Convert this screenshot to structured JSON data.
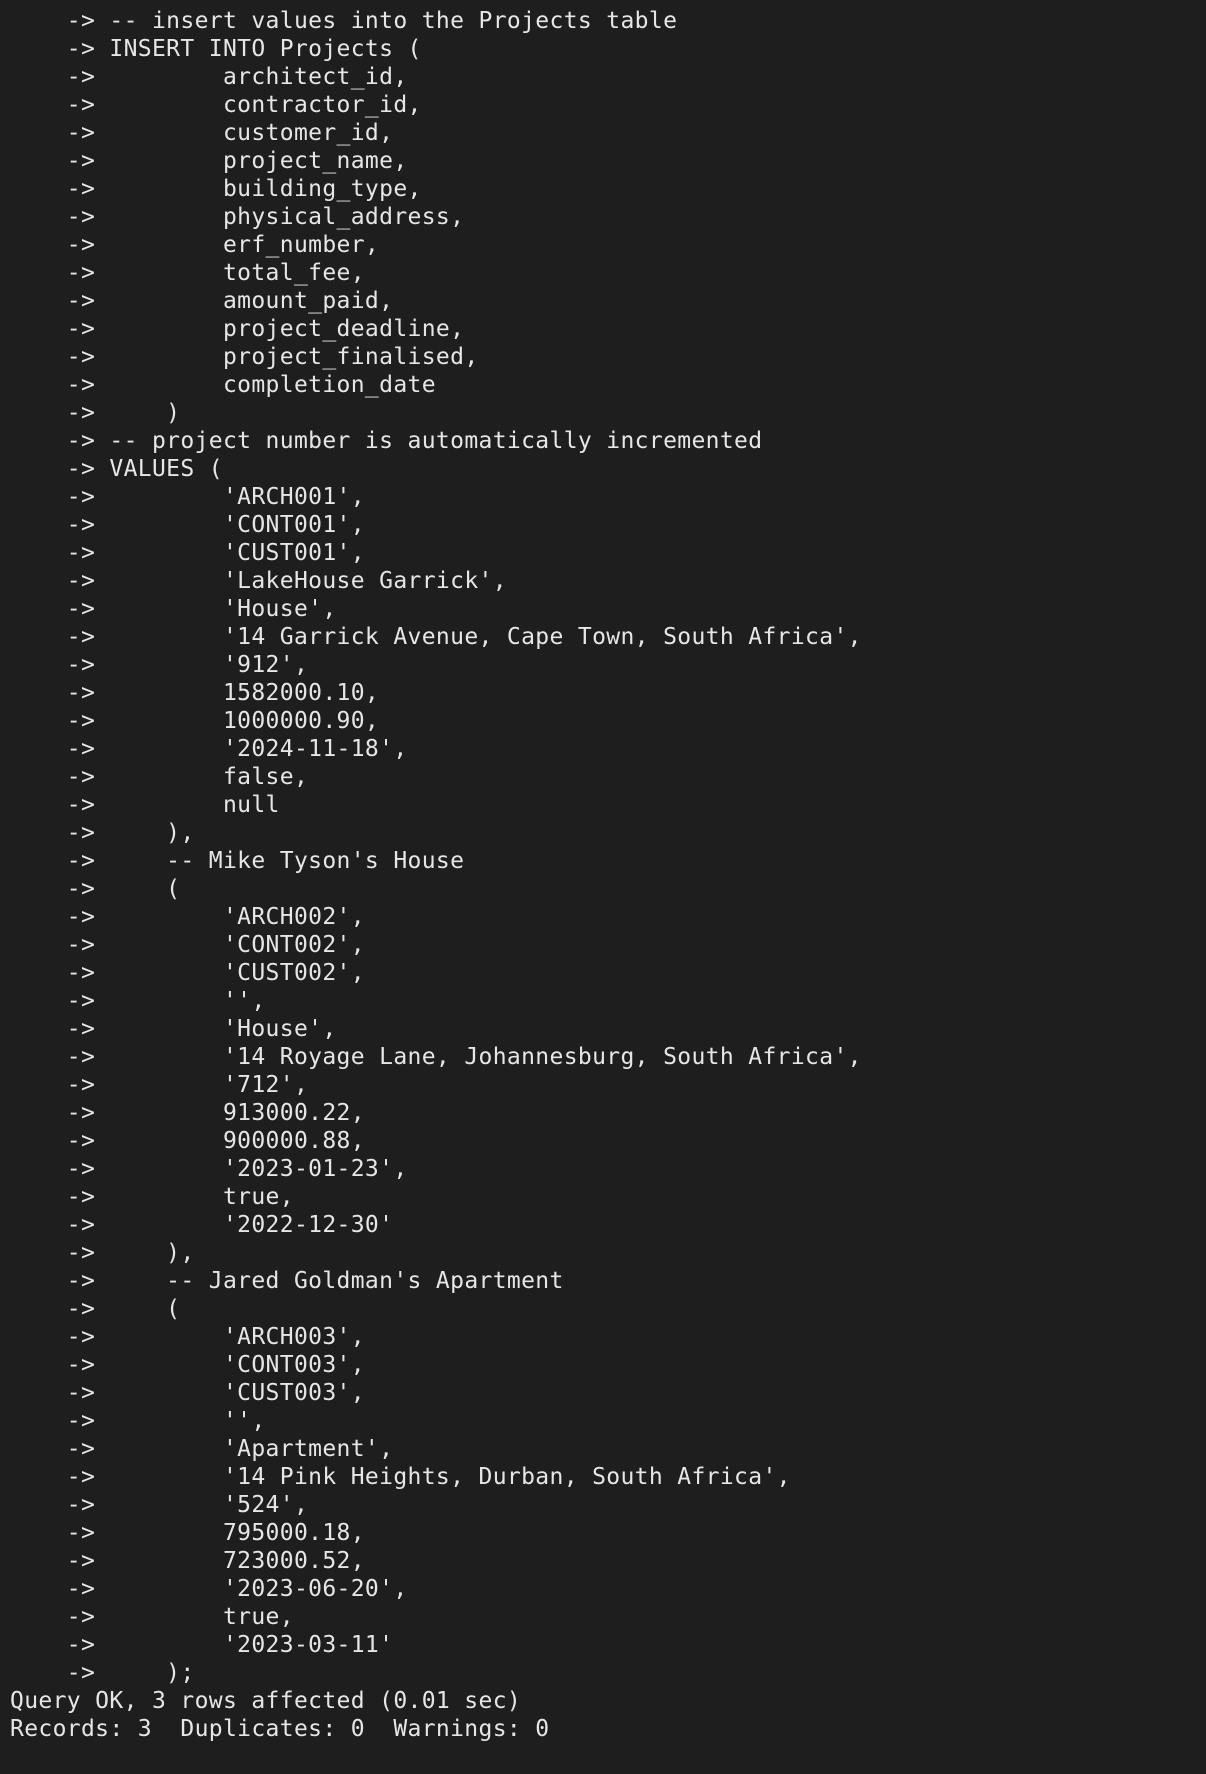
{
  "terminal": {
    "background": "#1e1e1e",
    "foreground": "#e6e6e6",
    "continuation_prompt": "    ->",
    "lines": [
      {
        "prompt": true,
        "text": " -- insert values into the Projects table"
      },
      {
        "prompt": true,
        "text": " INSERT INTO Projects ("
      },
      {
        "prompt": true,
        "text": "         architect_id,"
      },
      {
        "prompt": true,
        "text": "         contractor_id,"
      },
      {
        "prompt": true,
        "text": "         customer_id,"
      },
      {
        "prompt": true,
        "text": "         project_name,"
      },
      {
        "prompt": true,
        "text": "         building_type,"
      },
      {
        "prompt": true,
        "text": "         physical_address,"
      },
      {
        "prompt": true,
        "text": "         erf_number,"
      },
      {
        "prompt": true,
        "text": "         total_fee,"
      },
      {
        "prompt": true,
        "text": "         amount_paid,"
      },
      {
        "prompt": true,
        "text": "         project_deadline,"
      },
      {
        "prompt": true,
        "text": "         project_finalised,"
      },
      {
        "prompt": true,
        "text": "         completion_date"
      },
      {
        "prompt": true,
        "text": "     )"
      },
      {
        "prompt": true,
        "text": " -- project number is automatically incremented"
      },
      {
        "prompt": true,
        "text": " VALUES ("
      },
      {
        "prompt": true,
        "text": "         'ARCH001',"
      },
      {
        "prompt": true,
        "text": "         'CONT001',"
      },
      {
        "prompt": true,
        "text": "         'CUST001',"
      },
      {
        "prompt": true,
        "text": "         'LakeHouse Garrick',"
      },
      {
        "prompt": true,
        "text": "         'House',"
      },
      {
        "prompt": true,
        "text": "         '14 Garrick Avenue, Cape Town, South Africa',"
      },
      {
        "prompt": true,
        "text": "         '912',"
      },
      {
        "prompt": true,
        "text": "         1582000.10,"
      },
      {
        "prompt": true,
        "text": "         1000000.90,"
      },
      {
        "prompt": true,
        "text": "         '2024-11-18',"
      },
      {
        "prompt": true,
        "text": "         false,"
      },
      {
        "prompt": true,
        "text": "         null"
      },
      {
        "prompt": true,
        "text": "     ),"
      },
      {
        "prompt": true,
        "text": "     -- Mike Tyson's House"
      },
      {
        "prompt": true,
        "text": "     ("
      },
      {
        "prompt": true,
        "text": "         'ARCH002',"
      },
      {
        "prompt": true,
        "text": "         'CONT002',"
      },
      {
        "prompt": true,
        "text": "         'CUST002',"
      },
      {
        "prompt": true,
        "text": "         '',"
      },
      {
        "prompt": true,
        "text": "         'House',"
      },
      {
        "prompt": true,
        "text": "         '14 Royage Lane, Johannesburg, South Africa',"
      },
      {
        "prompt": true,
        "text": "         '712',"
      },
      {
        "prompt": true,
        "text": "         913000.22,"
      },
      {
        "prompt": true,
        "text": "         900000.88,"
      },
      {
        "prompt": true,
        "text": "         '2023-01-23',"
      },
      {
        "prompt": true,
        "text": "         true,"
      },
      {
        "prompt": true,
        "text": "         '2022-12-30'"
      },
      {
        "prompt": true,
        "text": "     ),"
      },
      {
        "prompt": true,
        "text": "     -- Jared Goldman's Apartment"
      },
      {
        "prompt": true,
        "text": "     ("
      },
      {
        "prompt": true,
        "text": "         'ARCH003',"
      },
      {
        "prompt": true,
        "text": "         'CONT003',"
      },
      {
        "prompt": true,
        "text": "         'CUST003',"
      },
      {
        "prompt": true,
        "text": "         '',"
      },
      {
        "prompt": true,
        "text": "         'Apartment',"
      },
      {
        "prompt": true,
        "text": "         '14 Pink Heights, Durban, South Africa',"
      },
      {
        "prompt": true,
        "text": "         '524',"
      },
      {
        "prompt": true,
        "text": "         795000.18,"
      },
      {
        "prompt": true,
        "text": "         723000.52,"
      },
      {
        "prompt": true,
        "text": "         '2023-06-20',"
      },
      {
        "prompt": true,
        "text": "         true,"
      },
      {
        "prompt": true,
        "text": "         '2023-03-11'"
      },
      {
        "prompt": true,
        "text": "     );"
      },
      {
        "prompt": false,
        "text": "Query OK, 3 rows affected (0.01 sec)"
      },
      {
        "prompt": false,
        "text": "Records: 3  Duplicates: 0  Warnings: 0"
      }
    ]
  }
}
